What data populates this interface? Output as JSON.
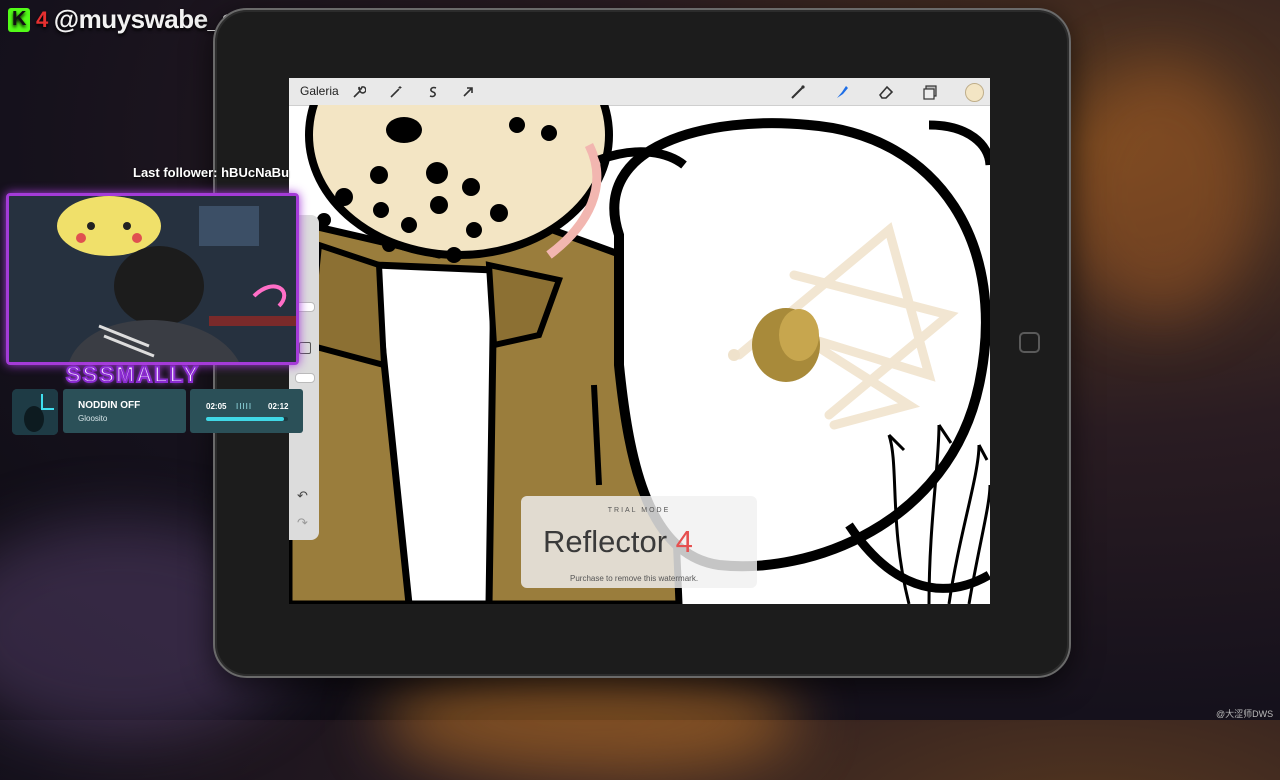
{
  "overlay": {
    "kick_logo": "K",
    "kick_number": "4",
    "handle": "@muyswabe_store",
    "last_follower": "Last follower: hBUcNaBu",
    "cam_name": "SSSMALLY",
    "credit": "@大涩师DWS"
  },
  "music": {
    "title": "NODDIN OFF",
    "artist": "Gloosito",
    "current_time": "02:05",
    "total_time": "02:12",
    "bars": "IIIII",
    "progress": 0.95
  },
  "procreate": {
    "gallery_label": "Galeria",
    "toolbar_left_icons": [
      "wrench-icon",
      "magic-wand-icon",
      "selection-s-icon",
      "transform-arrow-icon"
    ],
    "toolbar_right_icons": [
      "brush-icon",
      "smudge-icon",
      "eraser-icon",
      "layers-icon",
      "color-swatch"
    ],
    "current_color": "#f3e5c4",
    "undo_icon": "↶",
    "redo_icon": "↷"
  },
  "watermark": {
    "trial": "TRIAL MODE",
    "title_main": "Reflector ",
    "title_num": "4",
    "subtitle": "Purchase to remove this watermark."
  },
  "colors": {
    "accent_purple": "#a43bd8",
    "music_card": "#2b5058",
    "kick_green": "#53fc18",
    "jacket": "#9a7d3c",
    "mask_cream": "#f3e5c4"
  }
}
